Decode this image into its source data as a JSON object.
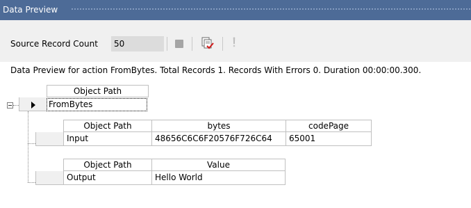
{
  "window": {
    "title": "Data Preview"
  },
  "toolbar": {
    "source_record_count_label": "Source Record Count",
    "source_record_count_value": "50",
    "stop_icon": "stop-icon",
    "validate_icon": "check-document-icon",
    "exclaim_icon": "exclamation-icon"
  },
  "status_text": "Data Preview for action FromBytes. Total Records 1. Records With Errors 0. Duration 00:00:00.300.",
  "root_grid": {
    "column_header": "Object Path",
    "row_value": "FromBytes"
  },
  "input_grid": {
    "columns": [
      "Object Path",
      "bytes",
      "codePage"
    ],
    "row": [
      "Input",
      "48656C6C6F20576F726C64",
      "65001"
    ]
  },
  "output_grid": {
    "columns": [
      "Object Path",
      "Value"
    ],
    "row": [
      "Output",
      "Hello World"
    ]
  },
  "colors": {
    "titlebar": "#4d6b97",
    "toolbar": "#f0f0f0",
    "input_bg": "#dcdcdc"
  }
}
